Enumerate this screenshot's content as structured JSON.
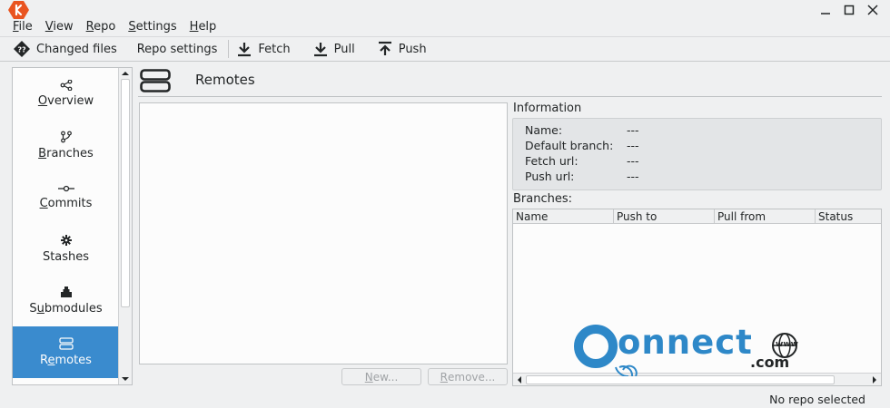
{
  "menubar": [
    {
      "prefix": "",
      "ul": "F",
      "rest": "ile"
    },
    {
      "prefix": "",
      "ul": "V",
      "rest": "iew"
    },
    {
      "prefix": "",
      "ul": "R",
      "rest": "epo"
    },
    {
      "prefix": "",
      "ul": "S",
      "rest": "ettings"
    },
    {
      "prefix": "",
      "ul": "H",
      "rest": "elp"
    }
  ],
  "toolbar": {
    "changed_files": "Changed files",
    "repo_settings": "Repo settings",
    "fetch": "Fetch",
    "pull": "Pull",
    "push": "Push"
  },
  "sidebar": {
    "items": [
      {
        "ul": "O",
        "rest": "verview",
        "icon": "share-icon"
      },
      {
        "ul": "B",
        "rest": "ranches",
        "icon": "branch-icon"
      },
      {
        "ul": "C",
        "rest": "ommits",
        "icon": "commit-icon"
      },
      {
        "ul": "",
        "rest": "Stashes",
        "icon": "stash-icon"
      },
      {
        "pre": "S",
        "ul": "u",
        "rest": "bmodules",
        "icon": "submodule-icon"
      },
      {
        "pre": "R",
        "ul": "e",
        "rest": "motes",
        "icon": "remotes-icon"
      }
    ],
    "active_index": 5
  },
  "page": {
    "title": "Remotes"
  },
  "actions": {
    "new": {
      "ul": "N",
      "rest": "ew..."
    },
    "remove": {
      "ul": "R",
      "rest": "emove..."
    }
  },
  "information": {
    "label": "Information",
    "rows": [
      {
        "key": "Name:",
        "value": "---"
      },
      {
        "key": "Default branch:",
        "value": "---"
      },
      {
        "key": "Fetch url:",
        "value": "---"
      },
      {
        "key": "Push url:",
        "value": "---"
      }
    ]
  },
  "branches": {
    "label": "Branches:",
    "columns": [
      "Name",
      "Push to",
      "Pull from",
      "Status"
    ],
    "rows": []
  },
  "watermark": {
    "main": "onnect",
    "com": ".com",
    "www": "www"
  },
  "status": "No repo selected",
  "colors": {
    "accent": "#3a8bce",
    "logo": "#e95420",
    "background": "#eff0f1"
  }
}
